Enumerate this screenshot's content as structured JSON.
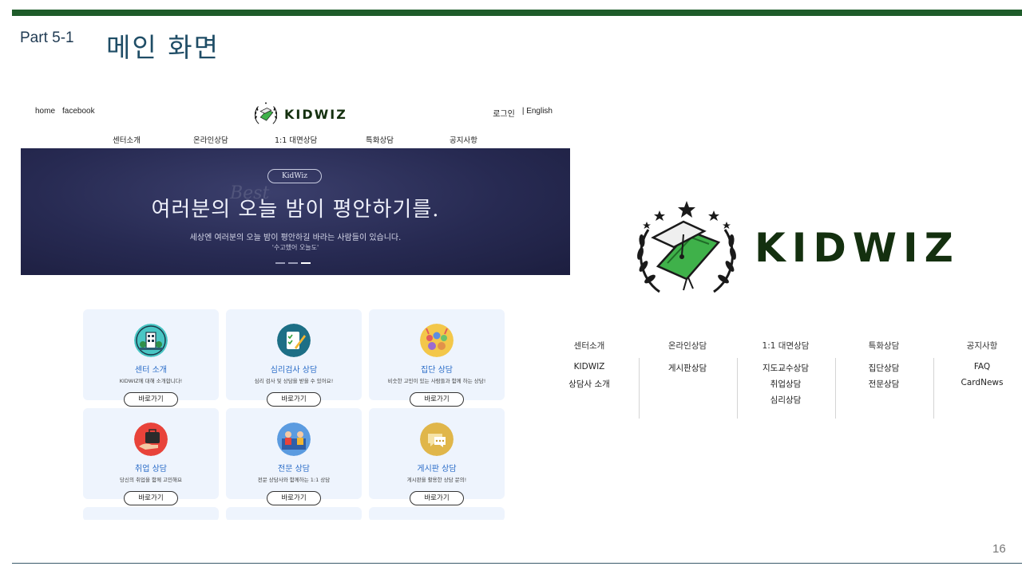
{
  "slide": {
    "part_label": "Part 5-1",
    "title": "메인 화면",
    "page_number": "16"
  },
  "site": {
    "top_links": [
      "home",
      "facebook"
    ],
    "logo_text": "KIDWIZ",
    "account_links": [
      "로그인",
      "| English"
    ],
    "nav": [
      "센터소개",
      "온라인상담",
      "1:1 대면상담",
      "특화상담",
      "공지사항"
    ],
    "hero": {
      "pill": "KidWiz",
      "title": "여러분의 오늘 밤이 평안하기를.",
      "subtitle": "세상엔 여러분의 오늘 밤이 평안하길 바라는 사람들이 있습니다.",
      "quote": "'수고했어 오늘도'",
      "slide_count": 3,
      "active_slide": 3
    },
    "cards": [
      {
        "icon": "building-icon",
        "title": "센터 소개",
        "desc": "KIDWIZ에 대해 소개합니다!",
        "button": "바로가기"
      },
      {
        "icon": "checklist-pen-icon",
        "title": "심리검사 상담",
        "desc": "심리 검사 및 상담을 받을 수 있어요!",
        "button": "바로가기"
      },
      {
        "icon": "group-people-icon",
        "title": "집단 상담",
        "desc": "비슷한 고민이 있는 사람들과 함께 하는 상담!",
        "button": "바로가기"
      },
      {
        "icon": "briefcase-hand-icon",
        "title": "취업 상담",
        "desc": "당신의 취업을 함께 고민해요",
        "button": "바로가기"
      },
      {
        "icon": "counselor-icon",
        "title": "전문 상담",
        "desc": "전문 상담사와 함께하는 1:1 상담",
        "button": "바로가기"
      },
      {
        "icon": "chat-bubble-icon",
        "title": "게시판 상담",
        "desc": "게시판을 활용한 상담 문의!",
        "button": "바로가기"
      }
    ]
  },
  "brand": {
    "logo_text": "KIDWIZ",
    "colors": {
      "green": "#1e5c2a",
      "logo_dark": "#14300f",
      "leaf": "#2f9e3a"
    }
  },
  "sitemap": [
    {
      "heading": "센터소개",
      "items": [
        "KIDWIZ",
        "상담사 소개"
      ]
    },
    {
      "heading": "온라인상담",
      "items": [
        "게시판상담"
      ]
    },
    {
      "heading": "1:1 대면상담",
      "items": [
        "지도교수상담",
        "취업상담",
        "심리상담"
      ]
    },
    {
      "heading": "특화상담",
      "items": [
        "집단상담",
        "전문상담"
      ]
    },
    {
      "heading": "공지사항",
      "items": [
        "FAQ",
        "CardNews"
      ]
    }
  ]
}
